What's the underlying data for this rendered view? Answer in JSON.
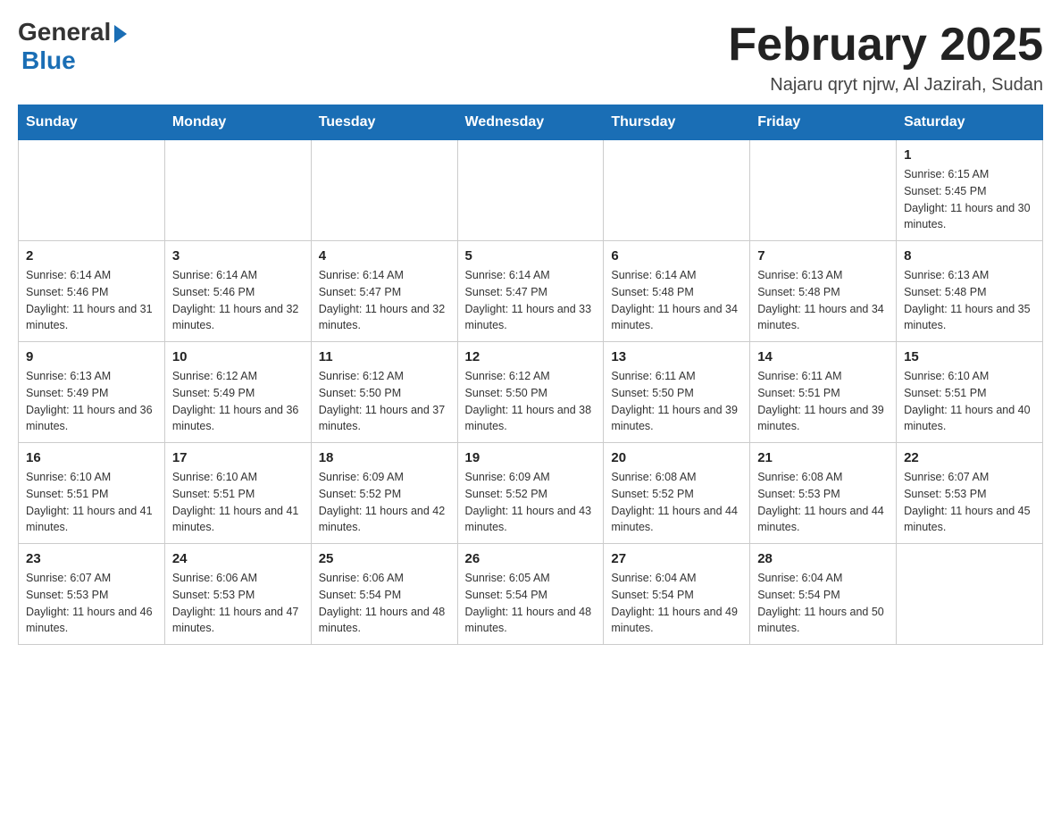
{
  "header": {
    "logo_general": "General",
    "logo_blue": "Blue",
    "title": "February 2025",
    "location": "Najaru qryt njrw, Al Jazirah, Sudan"
  },
  "days_of_week": [
    "Sunday",
    "Monday",
    "Tuesday",
    "Wednesday",
    "Thursday",
    "Friday",
    "Saturday"
  ],
  "weeks": [
    [
      {
        "day": "",
        "info": ""
      },
      {
        "day": "",
        "info": ""
      },
      {
        "day": "",
        "info": ""
      },
      {
        "day": "",
        "info": ""
      },
      {
        "day": "",
        "info": ""
      },
      {
        "day": "",
        "info": ""
      },
      {
        "day": "1",
        "info": "Sunrise: 6:15 AM\nSunset: 5:45 PM\nDaylight: 11 hours and 30 minutes."
      }
    ],
    [
      {
        "day": "2",
        "info": "Sunrise: 6:14 AM\nSunset: 5:46 PM\nDaylight: 11 hours and 31 minutes."
      },
      {
        "day": "3",
        "info": "Sunrise: 6:14 AM\nSunset: 5:46 PM\nDaylight: 11 hours and 32 minutes."
      },
      {
        "day": "4",
        "info": "Sunrise: 6:14 AM\nSunset: 5:47 PM\nDaylight: 11 hours and 32 minutes."
      },
      {
        "day": "5",
        "info": "Sunrise: 6:14 AM\nSunset: 5:47 PM\nDaylight: 11 hours and 33 minutes."
      },
      {
        "day": "6",
        "info": "Sunrise: 6:14 AM\nSunset: 5:48 PM\nDaylight: 11 hours and 34 minutes."
      },
      {
        "day": "7",
        "info": "Sunrise: 6:13 AM\nSunset: 5:48 PM\nDaylight: 11 hours and 34 minutes."
      },
      {
        "day": "8",
        "info": "Sunrise: 6:13 AM\nSunset: 5:48 PM\nDaylight: 11 hours and 35 minutes."
      }
    ],
    [
      {
        "day": "9",
        "info": "Sunrise: 6:13 AM\nSunset: 5:49 PM\nDaylight: 11 hours and 36 minutes."
      },
      {
        "day": "10",
        "info": "Sunrise: 6:12 AM\nSunset: 5:49 PM\nDaylight: 11 hours and 36 minutes."
      },
      {
        "day": "11",
        "info": "Sunrise: 6:12 AM\nSunset: 5:50 PM\nDaylight: 11 hours and 37 minutes."
      },
      {
        "day": "12",
        "info": "Sunrise: 6:12 AM\nSunset: 5:50 PM\nDaylight: 11 hours and 38 minutes."
      },
      {
        "day": "13",
        "info": "Sunrise: 6:11 AM\nSunset: 5:50 PM\nDaylight: 11 hours and 39 minutes."
      },
      {
        "day": "14",
        "info": "Sunrise: 6:11 AM\nSunset: 5:51 PM\nDaylight: 11 hours and 39 minutes."
      },
      {
        "day": "15",
        "info": "Sunrise: 6:10 AM\nSunset: 5:51 PM\nDaylight: 11 hours and 40 minutes."
      }
    ],
    [
      {
        "day": "16",
        "info": "Sunrise: 6:10 AM\nSunset: 5:51 PM\nDaylight: 11 hours and 41 minutes."
      },
      {
        "day": "17",
        "info": "Sunrise: 6:10 AM\nSunset: 5:51 PM\nDaylight: 11 hours and 41 minutes."
      },
      {
        "day": "18",
        "info": "Sunrise: 6:09 AM\nSunset: 5:52 PM\nDaylight: 11 hours and 42 minutes."
      },
      {
        "day": "19",
        "info": "Sunrise: 6:09 AM\nSunset: 5:52 PM\nDaylight: 11 hours and 43 minutes."
      },
      {
        "day": "20",
        "info": "Sunrise: 6:08 AM\nSunset: 5:52 PM\nDaylight: 11 hours and 44 minutes."
      },
      {
        "day": "21",
        "info": "Sunrise: 6:08 AM\nSunset: 5:53 PM\nDaylight: 11 hours and 44 minutes."
      },
      {
        "day": "22",
        "info": "Sunrise: 6:07 AM\nSunset: 5:53 PM\nDaylight: 11 hours and 45 minutes."
      }
    ],
    [
      {
        "day": "23",
        "info": "Sunrise: 6:07 AM\nSunset: 5:53 PM\nDaylight: 11 hours and 46 minutes."
      },
      {
        "day": "24",
        "info": "Sunrise: 6:06 AM\nSunset: 5:53 PM\nDaylight: 11 hours and 47 minutes."
      },
      {
        "day": "25",
        "info": "Sunrise: 6:06 AM\nSunset: 5:54 PM\nDaylight: 11 hours and 48 minutes."
      },
      {
        "day": "26",
        "info": "Sunrise: 6:05 AM\nSunset: 5:54 PM\nDaylight: 11 hours and 48 minutes."
      },
      {
        "day": "27",
        "info": "Sunrise: 6:04 AM\nSunset: 5:54 PM\nDaylight: 11 hours and 49 minutes."
      },
      {
        "day": "28",
        "info": "Sunrise: 6:04 AM\nSunset: 5:54 PM\nDaylight: 11 hours and 50 minutes."
      },
      {
        "day": "",
        "info": ""
      }
    ]
  ]
}
